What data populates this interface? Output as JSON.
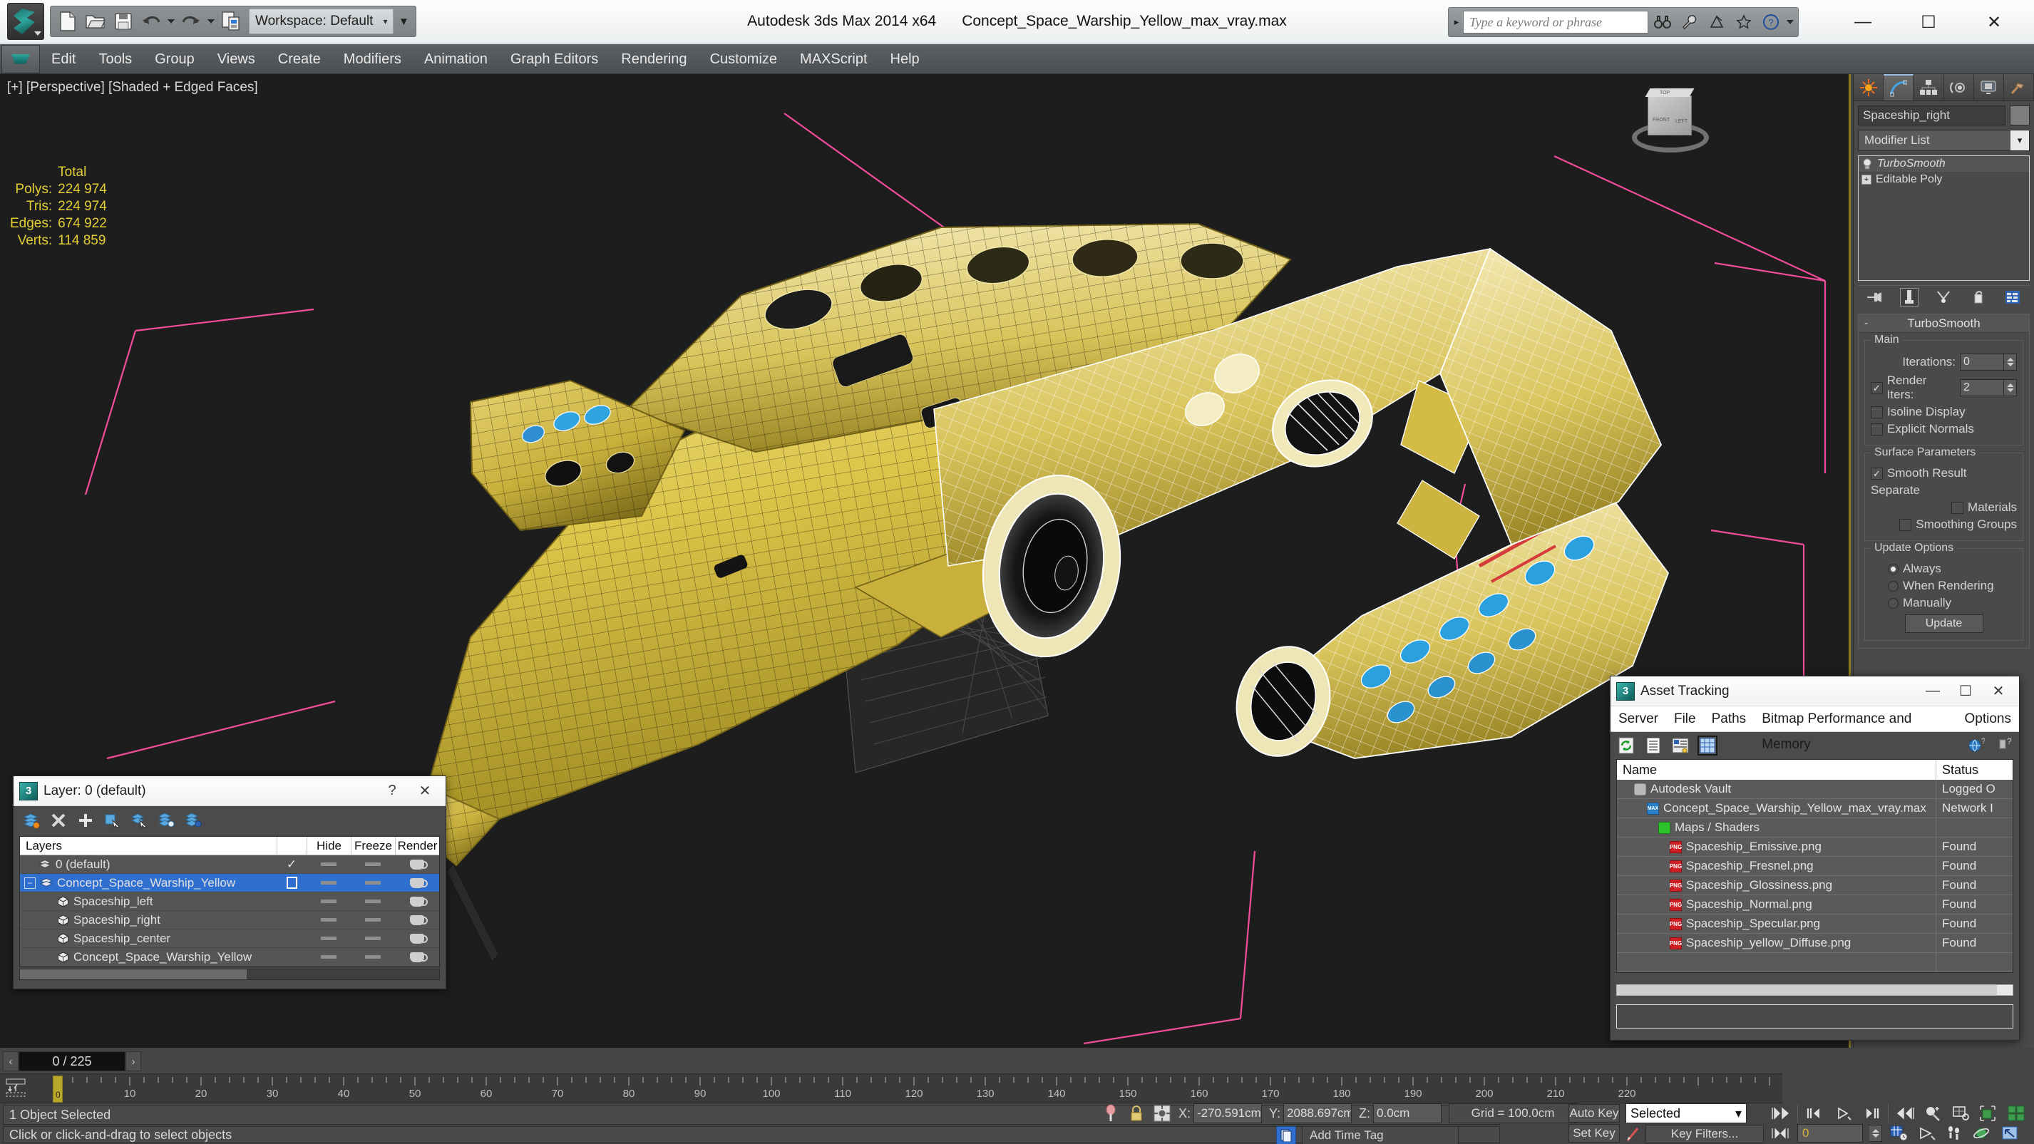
{
  "titlebar": {
    "app_title": "Autodesk 3ds Max  2014 x64",
    "file_name": "Concept_Space_Warship_Yellow_max_vray.max",
    "workspace_label": "Workspace: Default",
    "workspace_dropdown": "▾",
    "workspace_flyout": "▼",
    "search_placeholder": "Type a keyword or phrase",
    "minimize": "—",
    "maximize": "☐",
    "close": "✕",
    "qat": [
      "new-icon",
      "open-icon",
      "save-icon",
      "undo-icon",
      "redo-icon",
      "render-setup-icon"
    ]
  },
  "menubar": {
    "items": [
      "Edit",
      "Tools",
      "Group",
      "Views",
      "Create",
      "Modifiers",
      "Animation",
      "Graph Editors",
      "Rendering",
      "Customize",
      "MAXScript",
      "Help"
    ]
  },
  "viewport": {
    "label": "[+] [Perspective] [Shaded + Edged Faces]",
    "stats": {
      "header": "Total",
      "rows": [
        {
          "label": "Polys:",
          "value": "224 974"
        },
        {
          "label": "Tris:",
          "value": "224 974"
        },
        {
          "label": "Edges:",
          "value": "674 922"
        },
        {
          "label": "Verts:",
          "value": "114 859"
        }
      ]
    },
    "viewcube_faces": [
      "TOP",
      "FRONT",
      "LEFT"
    ]
  },
  "command_panel": {
    "tabs": [
      "create-tab",
      "modify-tab",
      "hierarchy-tab",
      "motion-tab",
      "display-tab",
      "utilities-tab"
    ],
    "active_tab_index": 1,
    "object_name": "Spaceship_right",
    "modifier_list_label": "Modifier List",
    "modifier_stack": [
      {
        "name": "TurboSmooth",
        "italic": true,
        "selected": true
      },
      {
        "name": "Editable Poly",
        "italic": false,
        "selected": false
      }
    ],
    "rollout_title": "TurboSmooth",
    "collapse_sign": "-",
    "groups": {
      "main": {
        "title": "Main",
        "iterations_label": "Iterations:",
        "iterations_value": "0",
        "render_iters_label": "Render Iters:",
        "render_iters_value": "2",
        "render_iters_checked": true,
        "isoline_label": "Isoline Display",
        "isoline_checked": false,
        "explicit_label": "Explicit Normals",
        "explicit_checked": false
      },
      "surface": {
        "title": "Surface Parameters",
        "smooth_result_label": "Smooth Result",
        "smooth_result_checked": true,
        "separate_label": "Separate",
        "materials_label": "Materials",
        "materials_checked": false,
        "smoothing_groups_label": "Smoothing Groups",
        "smoothing_groups_checked": false
      },
      "update": {
        "title": "Update Options",
        "options": [
          {
            "label": "Always",
            "selected": true
          },
          {
            "label": "When Rendering",
            "selected": false
          },
          {
            "label": "Manually",
            "selected": false
          }
        ],
        "update_button": "Update"
      }
    }
  },
  "layer_dialog": {
    "title": "Layer: 0 (default)",
    "help_btn": "?",
    "close_btn": "✕",
    "toolbar_icons": [
      "create-new-layer-icon",
      "delete-layer-icon",
      "add-layer-icon",
      "select-objects-in-layer-icon",
      "select-highlighted-layer-icon",
      "highlight-selected-objects-layer-icon",
      "layer-properties-icon"
    ],
    "columns": [
      "Layers",
      "",
      "Hide",
      "Freeze",
      "Render"
    ],
    "rows": [
      {
        "name": "0 (default)",
        "indent": 1,
        "icon": "layer-icon",
        "current": true,
        "selected": false
      },
      {
        "name": "Concept_Space_Warship_Yellow",
        "indent": 0,
        "icon": "layer-icon",
        "current": false,
        "selected": true,
        "expander": "−"
      },
      {
        "name": "Spaceship_left",
        "indent": 2,
        "icon": "object-icon",
        "current": false,
        "selected": false
      },
      {
        "name": "Spaceship_right",
        "indent": 2,
        "icon": "object-icon",
        "current": false,
        "selected": false
      },
      {
        "name": "Spaceship_center",
        "indent": 2,
        "icon": "object-icon",
        "current": false,
        "selected": false
      },
      {
        "name": "Concept_Space_Warship_Yellow",
        "indent": 2,
        "icon": "object-icon",
        "current": false,
        "selected": false
      }
    ]
  },
  "asset_tracking": {
    "title": "Asset Tracking",
    "minimize": "—",
    "maximize": "☐",
    "close": "✕",
    "menu": [
      "Server",
      "File",
      "Paths",
      "Bitmap Performance and Memory",
      "Options"
    ],
    "toolbar_icons": [
      "refresh-icon",
      "list-view-icon",
      "details-view-icon",
      "grid-view-icon",
      "help-globe-icon",
      "help-icon"
    ],
    "columns": [
      "Name",
      "Status"
    ],
    "rows": [
      {
        "name": "Autodesk Vault",
        "status": "Logged O",
        "icon": "vault",
        "indent": 1
      },
      {
        "name": "Concept_Space_Warship_Yellow_max_vray.max",
        "status": "Network I",
        "icon": "max",
        "indent": 2
      },
      {
        "name": "Maps / Shaders",
        "status": "",
        "icon": "maps",
        "indent": 3
      },
      {
        "name": "Spaceship_Emissive.png",
        "status": "Found",
        "icon": "png",
        "indent": 4
      },
      {
        "name": "Spaceship_Fresnel.png",
        "status": "Found",
        "icon": "png",
        "indent": 4
      },
      {
        "name": "Spaceship_Glossiness.png",
        "status": "Found",
        "icon": "png",
        "indent": 4
      },
      {
        "name": "Spaceship_Normal.png",
        "status": "Found",
        "icon": "png",
        "indent": 4
      },
      {
        "name": "Spaceship_Specular.png",
        "status": "Found",
        "icon": "png",
        "indent": 4
      },
      {
        "name": "Spaceship_yellow_Diffuse.png",
        "status": "Found",
        "icon": "png",
        "indent": 4
      }
    ]
  },
  "bottom": {
    "frame_field": "0 / 225",
    "prev_frame": "‹",
    "next_frame": "›",
    "slider_label": "0",
    "ruler_ticks": [
      "0",
      "10",
      "20",
      "30",
      "40",
      "50",
      "60",
      "70",
      "80",
      "90",
      "100",
      "110",
      "120",
      "130",
      "140",
      "150",
      "160",
      "170",
      "180",
      "190",
      "200",
      "210",
      "220"
    ],
    "status_text": "1 Object Selected",
    "prompt_text": "Click or click-and-drag to select objects",
    "coords": {
      "x_label": "X:",
      "x_value": "-270.591cm",
      "y_label": "Y:",
      "y_value": "2088.697cm",
      "z_label": "Z:",
      "z_value": "0.0cm"
    },
    "grid_info": "Grid = 100.0cm",
    "add_time_tag": "Add Time Tag",
    "auto_key": "Auto Key",
    "set_key": "Set Key",
    "key_mode_selected": "Selected",
    "key_filters": "Key Filters...",
    "current_frame_field": "0"
  },
  "colors": {
    "accent_yellow": "#d8b43a",
    "selection_blue": "#2f6fd0",
    "viewport_bg": "#1d1d1d",
    "panel_bg": "#4a4a4a",
    "helper_pink": "#ff4fa3",
    "ship_yellow": "#d9c13a"
  }
}
